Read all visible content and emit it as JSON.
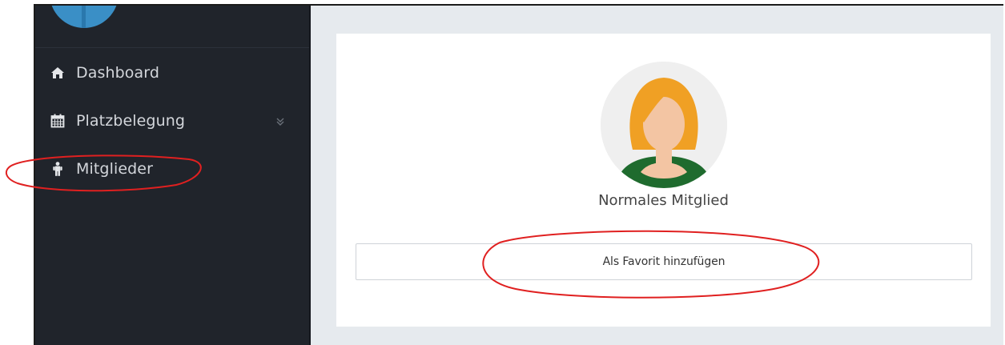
{
  "sidebar": {
    "items": [
      {
        "label": "Dashboard",
        "icon": "home-icon"
      },
      {
        "label": "Platzbelegung",
        "icon": "calendar-icon",
        "caret": "double-chevron-down-icon"
      },
      {
        "label": "Mitglieder",
        "icon": "person-icon"
      }
    ]
  },
  "profile": {
    "avatar_icon": "female-avatar-icon",
    "name": "Normales Mitglied",
    "favorite_button_label": "Als Favorit hinzufügen"
  },
  "colors": {
    "sidebar_bg": "#20242b",
    "content_bg": "#e6eaee",
    "card_bg": "#ffffff",
    "annotation_red": "#e02020",
    "avatar_hair": "#f0a024",
    "avatar_shirt": "#1f6b2e"
  }
}
